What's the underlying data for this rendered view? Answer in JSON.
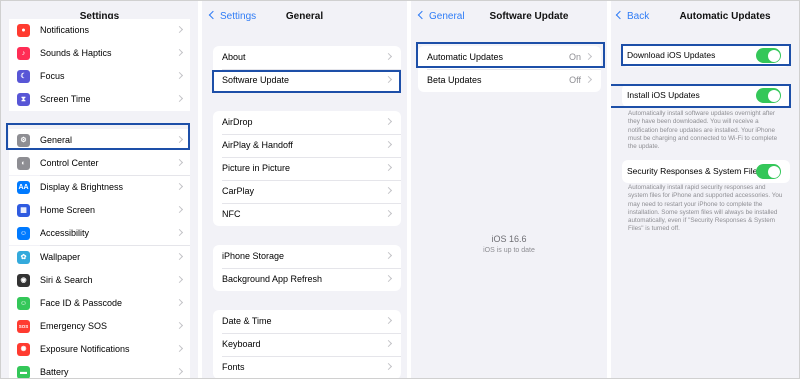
{
  "settings": {
    "title": "Settings",
    "items": [
      {
        "label": "Notifications",
        "color": "#ff3b30",
        "icon": "bell-icon",
        "glyph": "●"
      },
      {
        "label": "Sounds & Haptics",
        "color": "#ff2d55",
        "icon": "speaker-icon",
        "glyph": "♪"
      },
      {
        "label": "Focus",
        "color": "#5856d6",
        "icon": "moon-icon",
        "glyph": "☾"
      },
      {
        "label": "Screen Time",
        "color": "#5856d6",
        "icon": "hourglass-icon",
        "glyph": "⧗"
      },
      {
        "label": "General",
        "color": "#8e8e93",
        "icon": "gear-icon",
        "glyph": "⚙"
      },
      {
        "label": "Control Center",
        "color": "#8e8e93",
        "icon": "toggles-icon",
        "glyph": "◐"
      },
      {
        "label": "Display & Brightness",
        "color": "#007aff",
        "icon": "text-size-icon",
        "glyph": "AA"
      },
      {
        "label": "Home Screen",
        "color": "#2f5be0",
        "icon": "grid-icon",
        "glyph": "▦"
      },
      {
        "label": "Accessibility",
        "color": "#007aff",
        "icon": "accessibility-icon",
        "glyph": "☺"
      },
      {
        "label": "Wallpaper",
        "color": "#34aadc",
        "icon": "flower-icon",
        "glyph": "✿"
      },
      {
        "label": "Siri & Search",
        "color": "#333333",
        "icon": "siri-icon",
        "glyph": "◉"
      },
      {
        "label": "Face ID & Passcode",
        "color": "#34c759",
        "icon": "face-id-icon",
        "glyph": "☺"
      },
      {
        "label": "Emergency SOS",
        "color": "#ff3b30",
        "icon": "sos-icon",
        "glyph": "SOS"
      },
      {
        "label": "Exposure Notifications",
        "color": "#ff3b30",
        "icon": "exposure-icon",
        "glyph": "✺"
      },
      {
        "label": "Battery",
        "color": "#34c759",
        "icon": "battery-icon",
        "glyph": "▬"
      }
    ]
  },
  "general": {
    "back": "Settings",
    "title": "General",
    "groups": [
      [
        "About",
        "Software Update"
      ],
      [
        "AirDrop",
        "AirPlay & Handoff",
        "Picture in Picture",
        "CarPlay",
        "NFC"
      ],
      [
        "iPhone Storage",
        "Background App Refresh"
      ],
      [
        "Date & Time",
        "Keyboard",
        "Fonts"
      ]
    ]
  },
  "software_update": {
    "back": "General",
    "title": "Software Update",
    "rows": [
      {
        "label": "Automatic Updates",
        "value": "On"
      },
      {
        "label": "Beta Updates",
        "value": "Off"
      }
    ],
    "version": "iOS 16.6",
    "status": "iOS is up to date"
  },
  "automatic_updates": {
    "back": "Back",
    "title": "Automatic Updates",
    "download_label": "Download iOS Updates",
    "install_label": "Install iOS Updates",
    "install_desc": "Automatically install software updates overnight after they have been downloaded. You will receive a notification before updates are installed. Your iPhone must be charging and connected to Wi-Fi to complete the update.",
    "security_label": "Security Responses & System Files",
    "security_desc": "Automatically install rapid security responses and system files for iPhone and supported accessories. You may need to restart your iPhone to complete the installation. Some system files will always be installed automatically, even if \"Security Responses & System Files\" is turned off."
  },
  "highlight_color": "#1d4fa8",
  "accent": "#2f7cf6",
  "toggle_on_color": "#34c759"
}
